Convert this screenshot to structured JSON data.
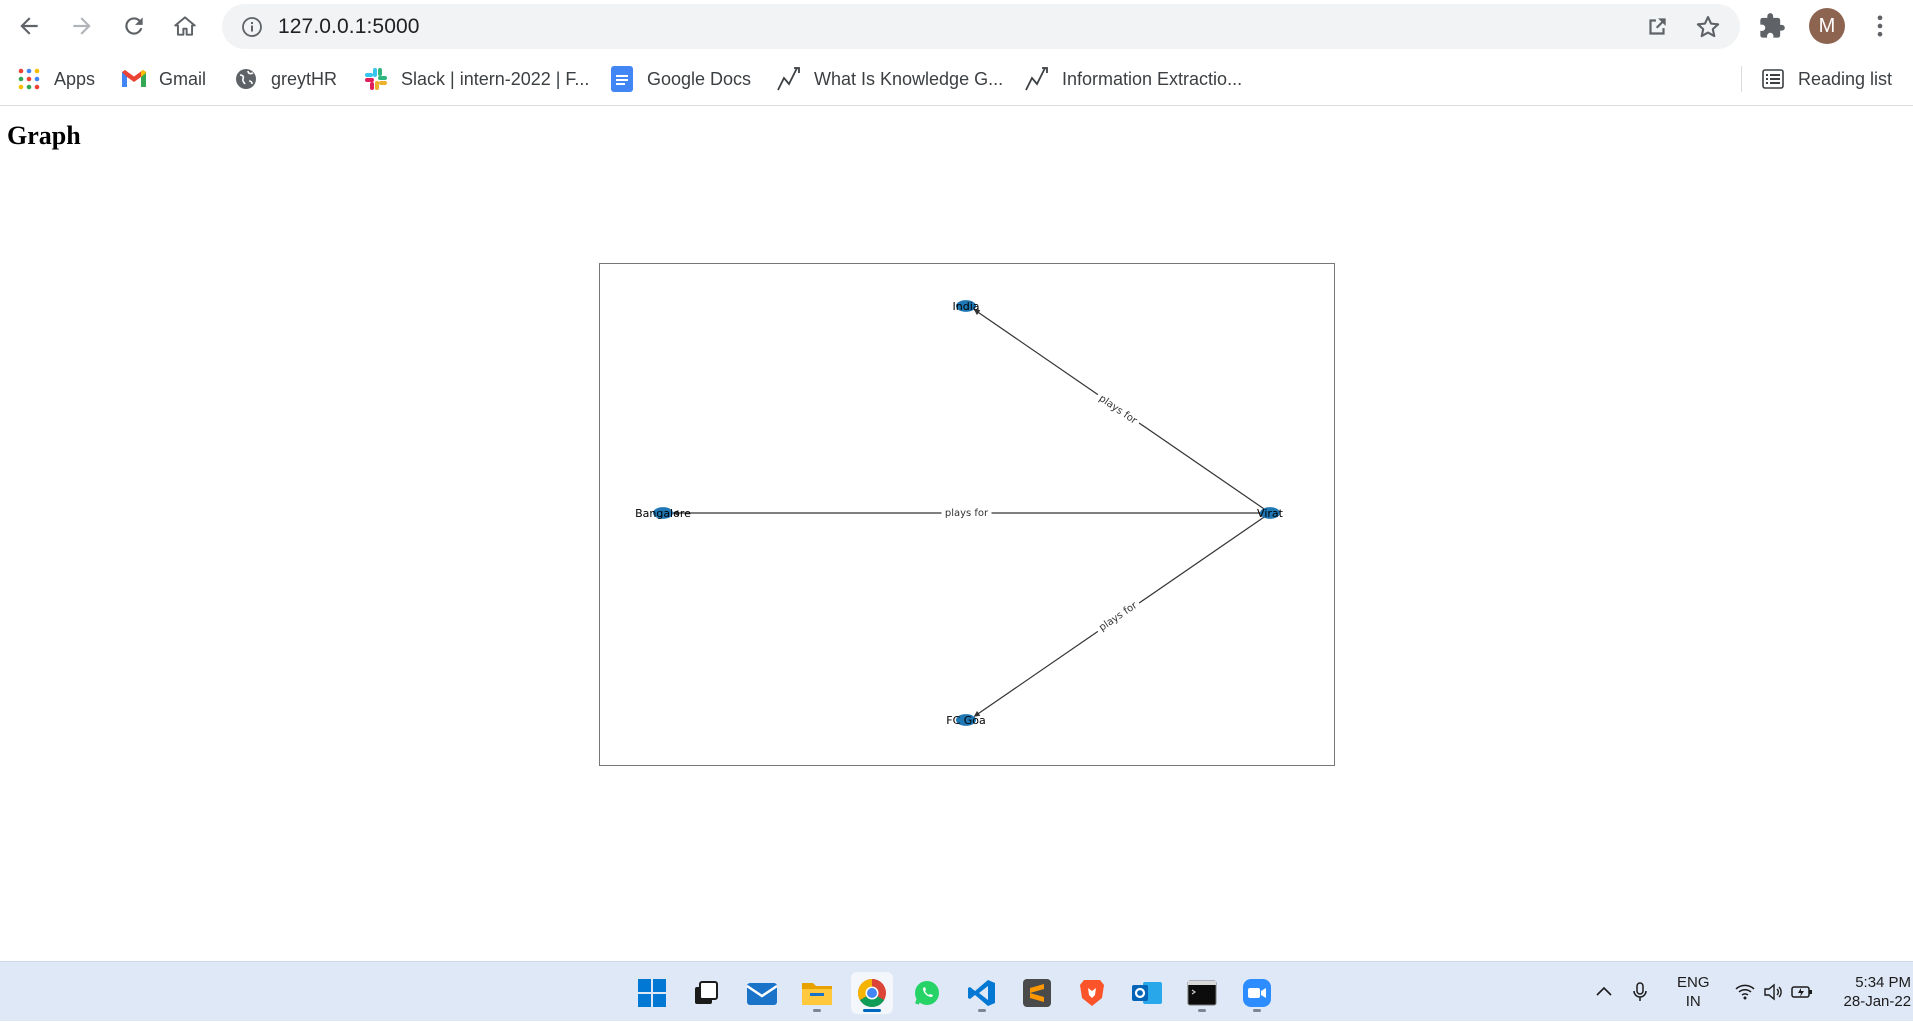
{
  "browser": {
    "url": "127.0.0.1:5000",
    "avatar_letter": "M",
    "bookmarks": [
      {
        "label": "Apps",
        "icon": "apps-grid-icon"
      },
      {
        "label": "Gmail",
        "icon": "gmail-icon"
      },
      {
        "label": "greytHR",
        "icon": "greythr-globe-icon"
      },
      {
        "label": "Slack | intern-2022 | F...",
        "icon": "slack-icon"
      },
      {
        "label": "Google Docs",
        "icon": "google-docs-icon"
      },
      {
        "label": "What Is Knowledge G...",
        "icon": "trend-icon"
      },
      {
        "label": "Information Extractio...",
        "icon": "trend-icon"
      }
    ],
    "reading_list": "Reading list"
  },
  "page": {
    "heading": "Graph"
  },
  "graph": {
    "nodes": [
      "India",
      "Bangalore",
      "Virat",
      "FC Goa"
    ],
    "edges": [
      {
        "from": "Virat",
        "to": "India",
        "label": "plays for"
      },
      {
        "from": "Virat",
        "to": "Bangalore",
        "label": "plays for"
      },
      {
        "from": "Virat",
        "to": "FC Goa",
        "label": "plays for"
      }
    ],
    "node_color": "#1f77b4"
  },
  "taskbar": {
    "apps": [
      "start-icon",
      "task-view-icon",
      "mail-icon",
      "file-explorer-icon",
      "chrome-icon",
      "whatsapp-icon",
      "vscode-icon",
      "sublime-icon",
      "brave-icon",
      "outlook-icon",
      "terminal-icon",
      "zoom-icon"
    ],
    "language_line1": "ENG",
    "language_line2": "IN",
    "time": "5:34 PM",
    "date": "28-Jan-22"
  }
}
